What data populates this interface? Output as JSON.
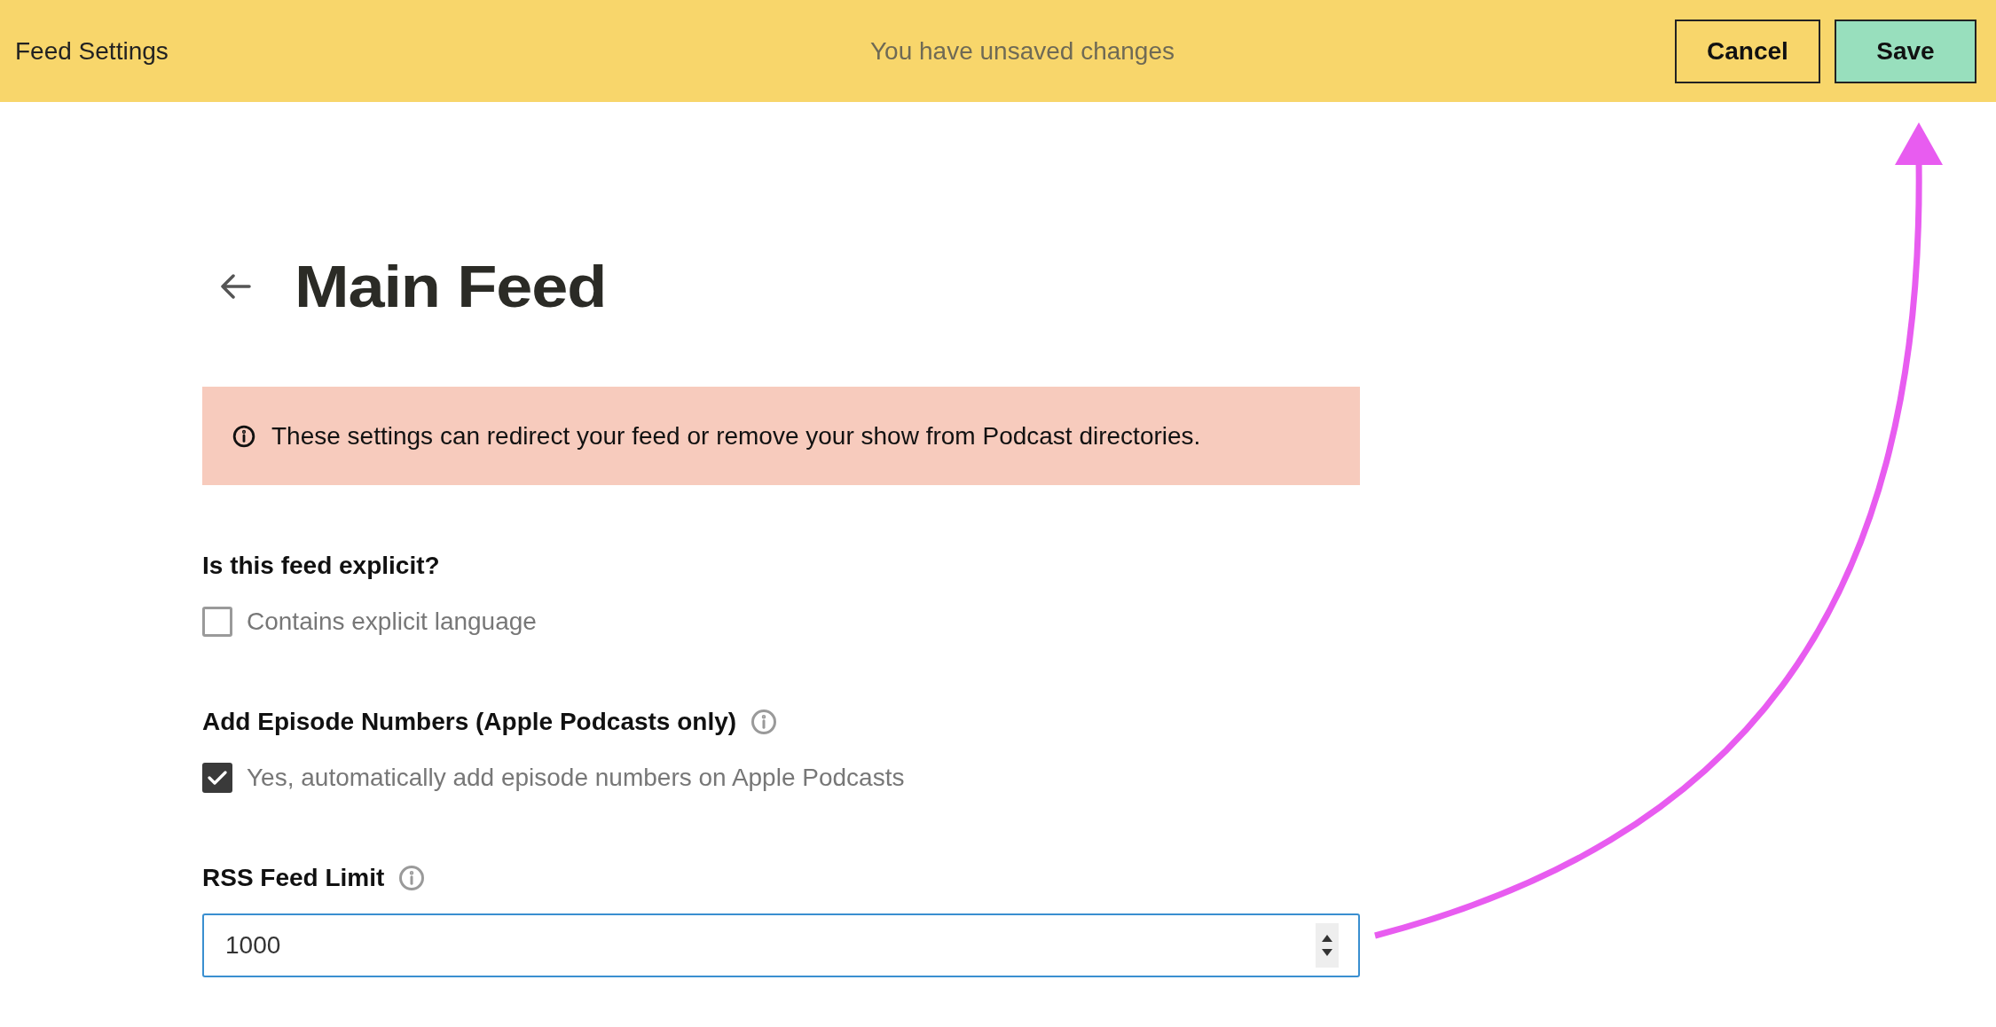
{
  "top_bar": {
    "title": "Feed Settings",
    "status": "You have unsaved changes",
    "buttons": [
      {
        "label": "Cancel",
        "kind": "secondary"
      },
      {
        "label": "Save",
        "kind": "primary"
      }
    ]
  },
  "page": {
    "title": "Main Feed"
  },
  "warning": {
    "text": "These settings can redirect your feed or remove your show from Podcast directories."
  },
  "sections": [
    {
      "heading": "Is this feed explicit?",
      "info": false,
      "kind": "checkbox",
      "label": "Contains explicit language",
      "checked": false
    },
    {
      "heading": "Add Episode Numbers (Apple Podcasts only)",
      "info": true,
      "kind": "checkbox",
      "label": "Yes, automatically add episode numbers on Apple Podcasts",
      "checked": true
    },
    {
      "heading": "RSS Feed Limit",
      "info": true,
      "kind": "number",
      "value": "1000"
    }
  ]
}
